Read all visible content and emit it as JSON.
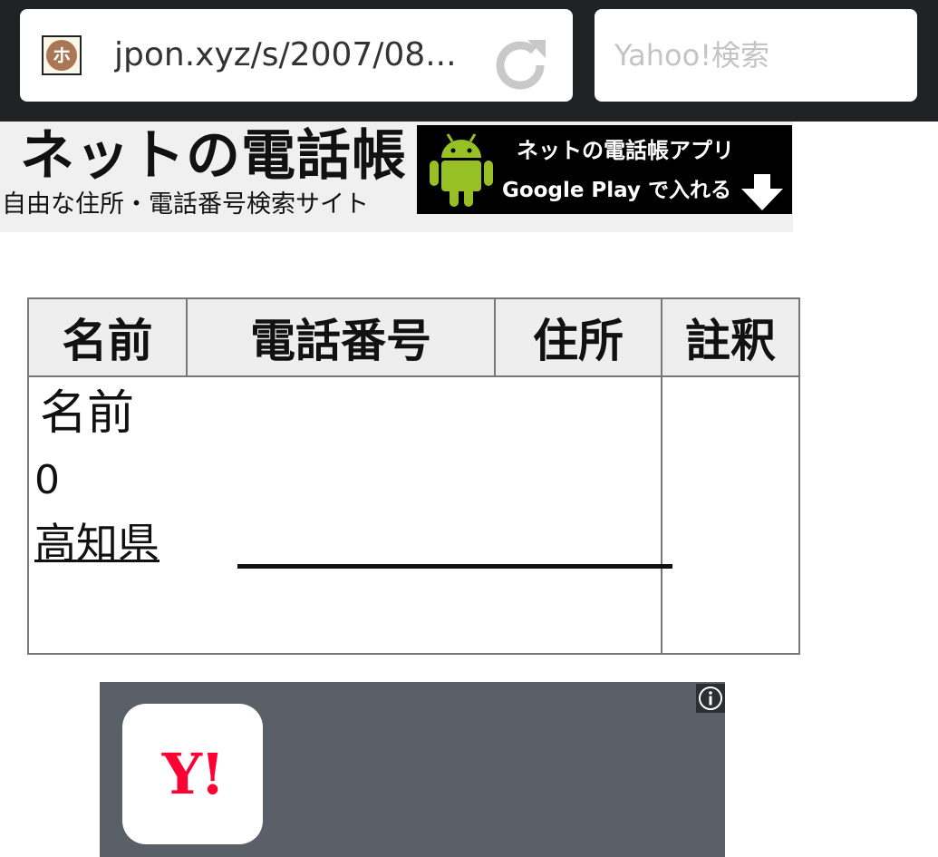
{
  "browser": {
    "url": "jpon.xyz/s/2007/08...",
    "search_placeholder": "Yahoo!検索",
    "site_icon_glyph": "ホ"
  },
  "site": {
    "title": "ネットの電話帳",
    "subtitle": "自由な住所・電話番号検索サイト",
    "app_banner": {
      "line1": "ネットの電話帳アプリ",
      "line2": "Google Play で入れる"
    }
  },
  "table": {
    "headers": [
      "名前",
      "電話番号",
      "住所",
      "註釈"
    ],
    "record": {
      "name": "名前",
      "phone": "0",
      "address": "高知県"
    }
  },
  "ad": {
    "app_icon_text": "Y!"
  },
  "colors": {
    "topbar": "#1f2326",
    "ad_background": "#5a6068",
    "yahoo_red": "#ff0033",
    "header_bg": "#f0f0f0"
  }
}
